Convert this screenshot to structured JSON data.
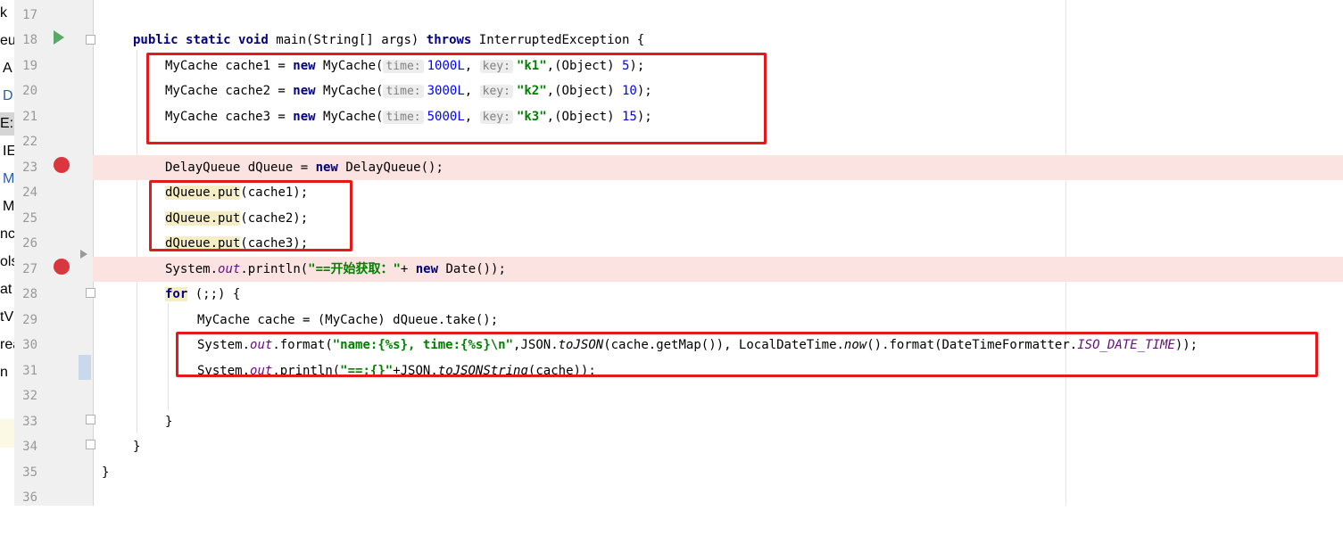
{
  "left_panel": [
    "k",
    "eu",
    "A",
    "D",
    "E:",
    "IE",
    "M",
    "M",
    "ncl",
    "ols",
    "at",
    "tV",
    "rea",
    "n"
  ],
  "line_numbers": [
    "17",
    "18",
    "19",
    "20",
    "21",
    "22",
    "23",
    "24",
    "25",
    "26",
    "27",
    "28",
    "29",
    "30",
    "31",
    "32",
    "33",
    "34",
    "35",
    "36"
  ],
  "code": {
    "l18": {
      "kw1": "public",
      "kw2": "static",
      "kw3": "void",
      "sig": "main(String[] args)",
      "kw4": "throws",
      "ex": "InterruptedException {"
    },
    "l19": {
      "a": "MyCache cache1 = ",
      "kw": "new",
      "b": "MyCache(",
      "h1": "time:",
      "n1": "1000L",
      "c1": ",",
      "h2": "key:",
      "s": "\"k1\"",
      "c2": ",(Object) ",
      "n2": "5",
      "e": ");"
    },
    "l20": {
      "a": "MyCache cache2 = ",
      "kw": "new",
      "b": "MyCache(",
      "h1": "time:",
      "n1": "3000L",
      "c1": ",",
      "h2": "key:",
      "s": "\"k2\"",
      "c2": ",(Object) ",
      "n2": "10",
      "e": ");"
    },
    "l21": {
      "a": "MyCache cache3 = ",
      "kw": "new",
      "b": "MyCache(",
      "h1": "time:",
      "n1": "5000L",
      "c1": ",",
      "h2": "key:",
      "s": "\"k3\"",
      "c2": ",(Object) ",
      "n2": "15",
      "e": ");"
    },
    "l23": {
      "a": "DelayQueue dQueue = ",
      "kw": "new",
      "b": "DelayQueue();"
    },
    "l24": {
      "a": "dQueue.put",
      "b": "(cache1);"
    },
    "l25": {
      "a": "dQueue.put",
      "b": "(cache2);"
    },
    "l26": {
      "a": "dQueue.put",
      "b": "(cache3);"
    },
    "l27": {
      "a": "System.",
      "f": "out",
      "b": ".println(",
      "s": "\"==开始获取：\"",
      "c": "+ ",
      "kw": "new",
      "d": "Date());"
    },
    "l28": {
      "kw": "for",
      "b": "(;;) {"
    },
    "l29": {
      "a": "MyCache cache = (MyCache) dQueue.take();"
    },
    "l30": {
      "a": "System.",
      "f": "out",
      "b": ".format(",
      "s": "\"name:{%s}, time:{%s}\\n\"",
      "c": ",JSON.",
      "m": "toJSON",
      "d": "(cache.getMap()), LocalDateTime.",
      "m2": "now",
      "e": "().format(DateTimeFormatter.",
      "f2": "ISO_DATE_TIME",
      "g": "));"
    },
    "l31": {
      "a": "System.",
      "f": "out",
      "b": ".println(",
      "s": "\"==:{}\"",
      "c": "+JSON.",
      "m": "toJSONString",
      "d": "(cache));"
    },
    "l33": {
      "a": "}"
    },
    "l34": {
      "a": "}"
    },
    "l35": {
      "a": "}"
    }
  }
}
